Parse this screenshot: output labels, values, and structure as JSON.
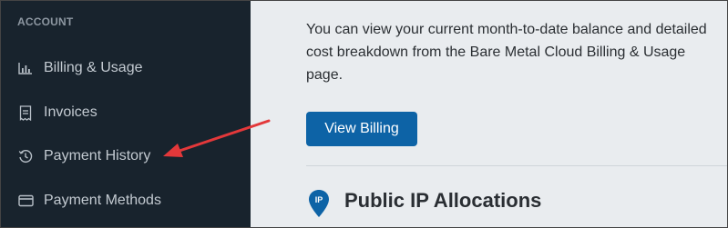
{
  "sidebar": {
    "section_heading": "ACCOUNT",
    "items": [
      {
        "label": "Billing & Usage",
        "icon": "bar-chart-icon"
      },
      {
        "label": "Invoices",
        "icon": "invoice-icon"
      },
      {
        "label": "Payment History",
        "icon": "history-icon"
      },
      {
        "label": "Payment Methods",
        "icon": "credit-card-icon"
      }
    ]
  },
  "main": {
    "intro_text": "You can view your current month-to-date balance and detailed cost breakdown from the Bare Metal Cloud Billing & Usage page.",
    "view_billing_label": "View Billing",
    "section_icon_text": "IP",
    "section_title": "Public IP Allocations"
  },
  "annotation": {
    "arrow_color": "#e3383a"
  },
  "colors": {
    "sidebar_bg": "#18232d",
    "main_bg": "#e9ecef",
    "accent": "#0d63a6"
  }
}
